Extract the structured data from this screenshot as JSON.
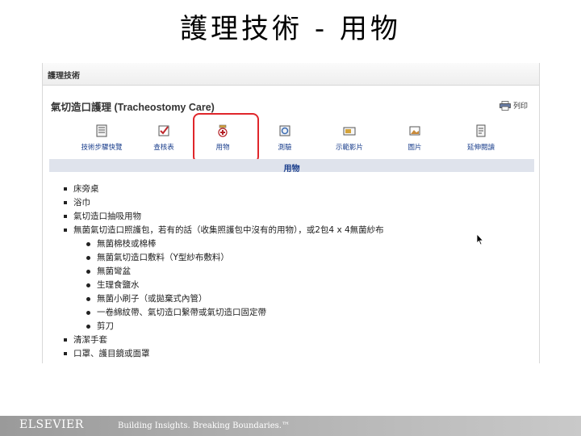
{
  "slide": {
    "title": "護理技術 - 用物"
  },
  "window": {
    "bar_title": "護理技術",
    "article_title": "氣切造口護理 (Tracheostomy Care)",
    "print_label": "列印"
  },
  "toolbar": {
    "items": [
      {
        "label": "技術步驟快覽",
        "icon": "steps-icon"
      },
      {
        "label": "查核表",
        "icon": "checklist-icon"
      },
      {
        "label": "用物",
        "icon": "supplies-icon",
        "selected": true
      },
      {
        "label": "測驗",
        "icon": "test-icon"
      },
      {
        "label": "示範影片",
        "icon": "video-icon"
      },
      {
        "label": "圖片",
        "icon": "image-icon"
      },
      {
        "label": "延伸閱讀",
        "icon": "reading-icon"
      }
    ]
  },
  "section": {
    "header": "用物"
  },
  "supplies": {
    "items": [
      "床旁桌",
      "浴巾",
      "氣切造口抽吸用物",
      "無菌氣切造口照護包，若有的話（收集照護包中沒有的用物），或2包4 x 4無菌紗布",
      "無菌棉枝或棉棒",
      "無菌氣切造口敷料（Y型紗布敷料）",
      "無菌彎盆",
      "生理食鹽水",
      "無菌小刷子（或拋棄式內管）",
      "一卷綿紋帶、氣切造口繫帶或氣切造口固定帶",
      "剪刀",
      "清潔手套",
      "口罩、護目鏡或面罩"
    ]
  },
  "footer": {
    "logo": "ELSEVIER",
    "tagline": "Building Insights. Breaking Boundaries.™"
  },
  "colors": {
    "highlight": "#e0262b",
    "link": "#1a3e8c",
    "section_bar": "#dfe3ec"
  }
}
